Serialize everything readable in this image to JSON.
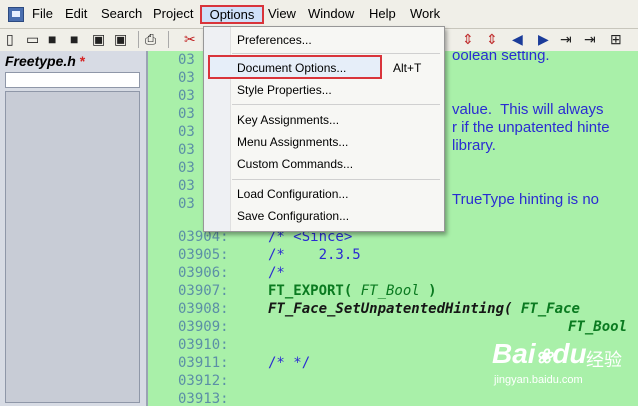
{
  "menubar": {
    "items": [
      "File",
      "Edit",
      "Search",
      "Project",
      "Options",
      "View",
      "Window",
      "Help",
      "Work"
    ],
    "active": "Options"
  },
  "sidebar": {
    "title": "Freetype.h",
    "modified_marker": "*"
  },
  "editor": {
    "lines": [
      {
        "num": "03",
        "code": "oolean setting."
      },
      {
        "num": "03",
        "code": ""
      },
      {
        "num": "03",
        "code": "value.  This will always"
      },
      {
        "num": "03",
        "code": "r if the unpatented hinte"
      },
      {
        "num": "03",
        "code": "library."
      },
      {
        "num": "03",
        "code": ""
      },
      {
        "num": "03",
        "code": ""
      },
      {
        "num": "03",
        "code": "TrueType hinting is no"
      },
      {
        "num": "03",
        "code": ""
      }
    ],
    "numbered_lines": [
      {
        "num": "03904:",
        "code": "/* <Since>"
      },
      {
        "num": "03905:",
        "code": "/*    2.3.5"
      },
      {
        "num": "03906:",
        "code": "/*"
      },
      {
        "num": "03907:",
        "code_parts": [
          "FT_EXPORT( ",
          "FT_Bool",
          " )"
        ]
      },
      {
        "num": "03908:",
        "code_parts": [
          "FT_Face_SetUnpatentedHinting( ",
          "FT_Face"
        ]
      },
      {
        "num": "03909:",
        "code_parts": [
          "",
          "FT_Bool"
        ]
      },
      {
        "num": "03910:",
        "code": ""
      },
      {
        "num": "03911:",
        "code": "/* */"
      },
      {
        "num": "03912:",
        "code": ""
      },
      {
        "num": "03913:",
        "code": ""
      }
    ]
  },
  "options_menu": {
    "items": [
      {
        "label": "Preferences...",
        "accel": ""
      },
      {
        "label": "Document Options...",
        "accel": "Alt+T"
      },
      {
        "label": "Style Properties...",
        "accel": ""
      },
      {
        "label": "Key Assignments...",
        "accel": ""
      },
      {
        "label": "Menu Assignments...",
        "accel": ""
      },
      {
        "label": "Custom Commands...",
        "accel": ""
      },
      {
        "label": "Load Configuration...",
        "accel": ""
      },
      {
        "label": "Save Configuration...",
        "accel": ""
      }
    ],
    "highlighted": "Document Options..."
  },
  "watermark": {
    "logo": "Bai",
    "logo_suffix": "du",
    "cn": "经验",
    "url": "jingyan.baidu.com"
  }
}
